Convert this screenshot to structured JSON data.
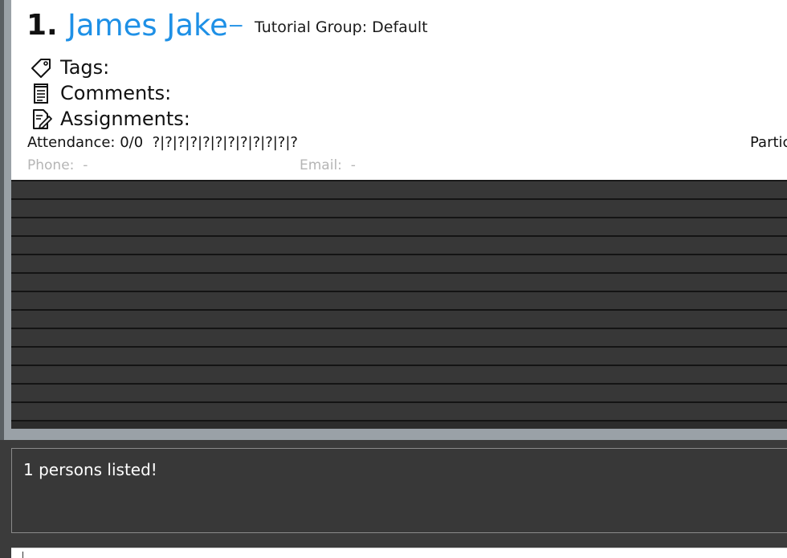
{
  "person_card": {
    "index": "1.",
    "name": "James Jake",
    "dash": "–",
    "tutorial_group": "Tutorial Group: Default",
    "tags_label": "Tags:",
    "comments_label": "Comments:",
    "assignments_label": "Assignments:",
    "attendance": "Attendance: 0/0  ?|?|?|?|?|?|?|?|?|?|?|?",
    "participation": "Partic",
    "phone": "Phone:  -",
    "email": "Email:  -"
  },
  "icons": {
    "tags": "tag-icon",
    "comments": "notepad-icon",
    "assignments": "document-edit-icon"
  },
  "result_display": {
    "text": "1 persons listed!"
  },
  "command_box": {
    "value": ""
  },
  "colors": {
    "name_accent": "#1e90e6",
    "background": "#3a3a3a",
    "row": "#373737"
  }
}
